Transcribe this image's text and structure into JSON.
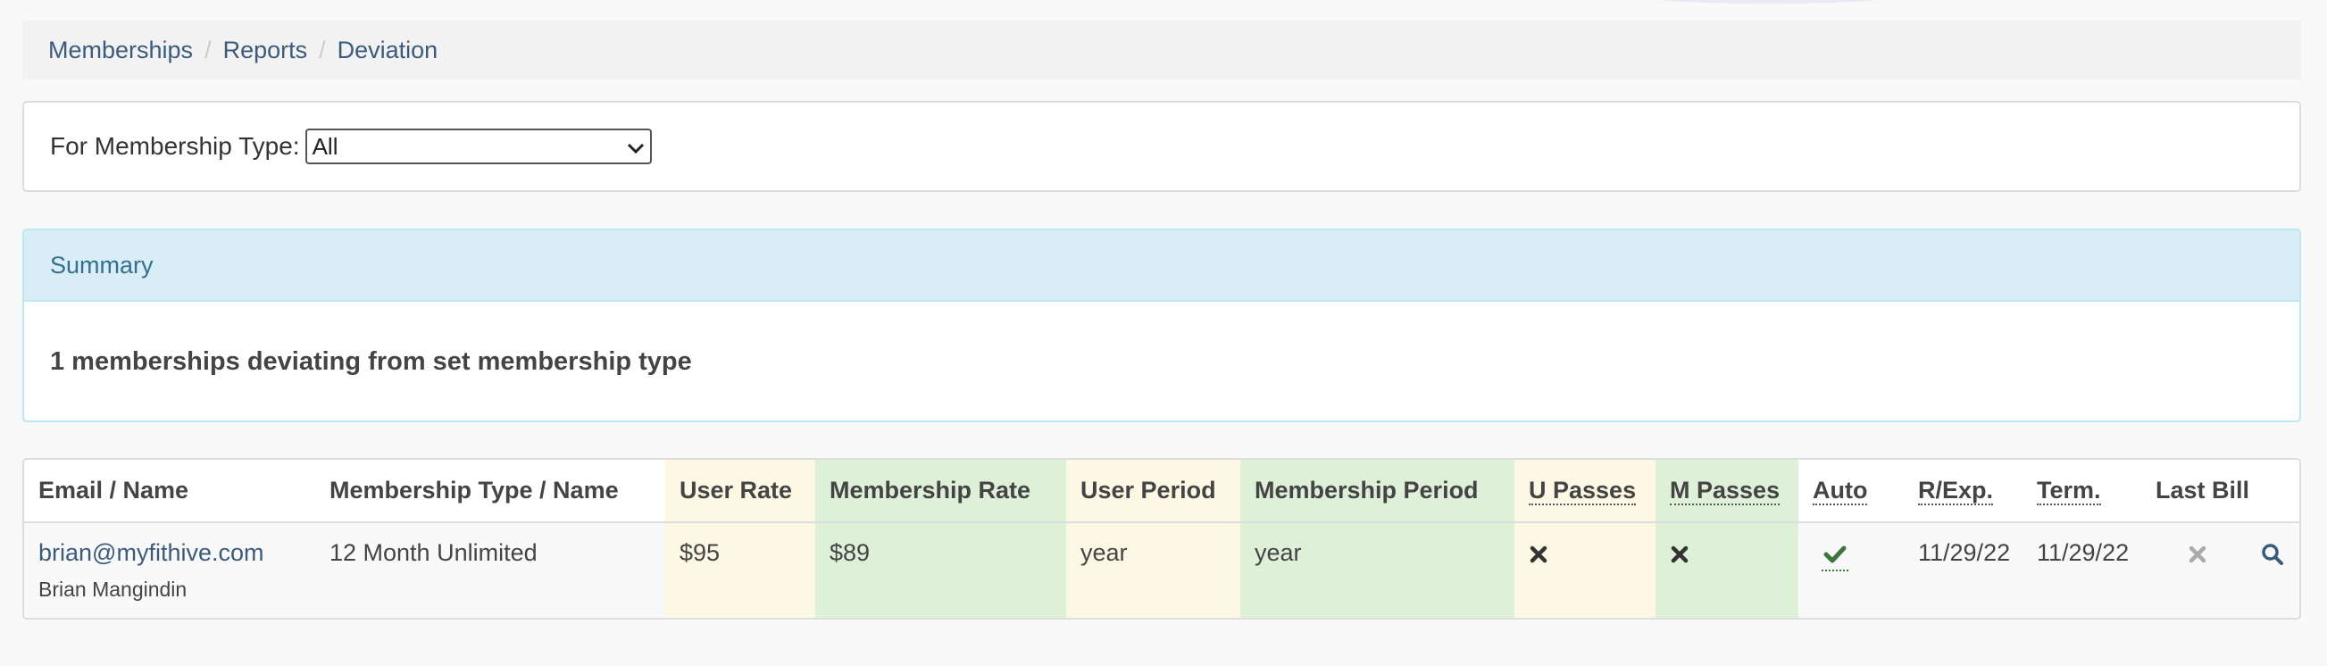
{
  "breadcrumb": {
    "items": [
      "Memberships",
      "Reports"
    ],
    "current": "Deviation",
    "separator": "/"
  },
  "filter": {
    "label": "For Membership Type:",
    "selected": "All"
  },
  "summary": {
    "heading": "Summary",
    "text": "1 memberships deviating from set membership type"
  },
  "table": {
    "headers": {
      "email_name": "Email / Name",
      "type_name": "Membership Type / Name",
      "user_rate": "User Rate",
      "membership_rate": "Membership Rate",
      "user_period": "User Period",
      "membership_period": "Membership Period",
      "u_passes": "U Passes",
      "m_passes": "M Passes",
      "auto": "Auto",
      "r_exp": "R/Exp.",
      "term": "Term.",
      "last_bill": "Last Bill"
    },
    "rows": [
      {
        "email": "brian@myfithive.com",
        "name": "Brian Mangindin",
        "type_name": "12 Month Unlimited",
        "user_rate": "$95",
        "membership_rate": "$89",
        "user_period": "year",
        "membership_period": "year",
        "u_passes_icon": "times-icon",
        "m_passes_icon": "times-icon",
        "auto_icon": "check-icon",
        "r_exp": "11/29/22",
        "term": "11/29/22",
        "last_bill_icon": "times-icon",
        "action_icon": "search-icon"
      }
    ]
  },
  "colors": {
    "link": "#3b5b7c",
    "warning_bg": "#fcf8e3",
    "success_bg": "#dff0d8",
    "info_bg": "#d9edf7",
    "info_text": "#31708f",
    "check": "#3c763d"
  }
}
